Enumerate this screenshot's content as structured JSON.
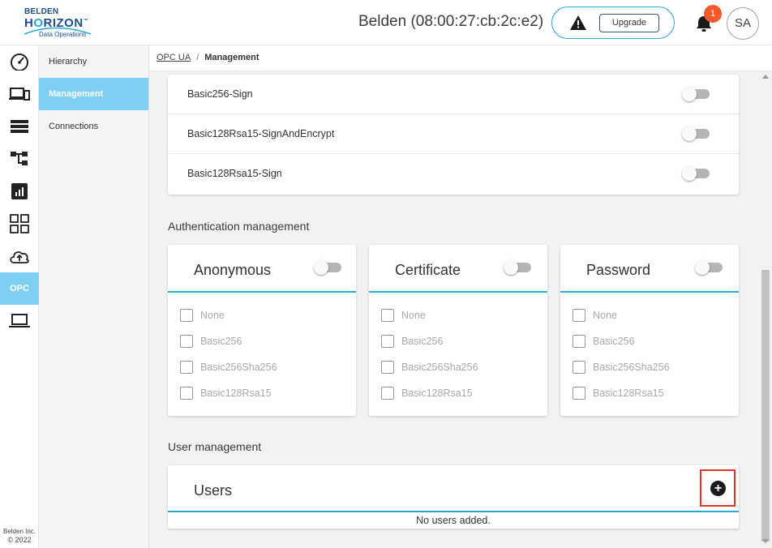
{
  "header": {
    "logo": {
      "line1": "BELDEN",
      "line2a": "H",
      "line2b": "O",
      "line2c": "RIZON",
      "trademark": "™",
      "tagline": "Data Operations"
    },
    "device_title": "Belden (08:00:27:cb:2c:e2)",
    "upgrade_label": "Upgrade",
    "notification_count": "1",
    "avatar_initials": "SA",
    "accent_color": "#29a8d8"
  },
  "rail": {
    "items": [
      {
        "icon": "dashboard-gauge-icon"
      },
      {
        "icon": "devices-icon"
      },
      {
        "icon": "list-icon"
      },
      {
        "icon": "hierarchy-icon"
      },
      {
        "icon": "chart-icon"
      },
      {
        "icon": "apps-grid-icon"
      },
      {
        "icon": "cloud-upload-icon"
      },
      {
        "label": "OPC",
        "active": true
      },
      {
        "icon": "laptop-icon"
      }
    ],
    "footer_company": "Belden Inc.",
    "footer_copyright": "© 2022"
  },
  "subnav": {
    "items": [
      {
        "label": "Hierarchy"
      },
      {
        "label": "Management",
        "active": true
      },
      {
        "label": "Connections"
      }
    ]
  },
  "breadcrumb": {
    "parent": "OPC UA",
    "separator": "/",
    "current": "Management"
  },
  "security_policies": [
    {
      "label": "Basic256-Sign",
      "enabled": false
    },
    {
      "label": "Basic128Rsa15-SignAndEncrypt",
      "enabled": false
    },
    {
      "label": "Basic128Rsa15-Sign",
      "enabled": false
    }
  ],
  "auth": {
    "title": "Authentication management",
    "cards": [
      {
        "title": "Anonymous",
        "enabled": false,
        "options": [
          "None",
          "Basic256",
          "Basic256Sha256",
          "Basic128Rsa15"
        ]
      },
      {
        "title": "Certificate",
        "enabled": false,
        "options": [
          "None",
          "Basic256",
          "Basic256Sha256",
          "Basic128Rsa15"
        ]
      },
      {
        "title": "Password",
        "enabled": false,
        "options": [
          "None",
          "Basic256",
          "Basic256Sha256",
          "Basic128Rsa15"
        ]
      }
    ]
  },
  "users": {
    "section_title": "User management",
    "card_title": "Users",
    "add_label": "+",
    "empty_message": "No users added."
  }
}
